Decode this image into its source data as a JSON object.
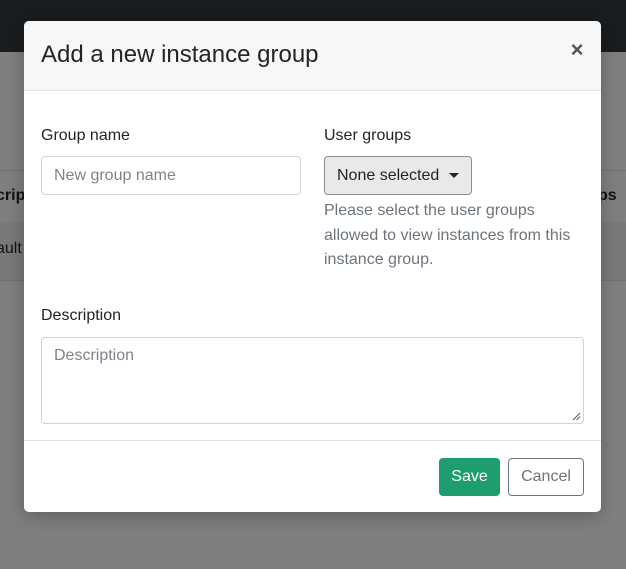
{
  "background": {
    "table_header_left": "cript",
    "table_header_right": "ps",
    "table_row_left": "ault"
  },
  "modal": {
    "title": "Add a new instance group",
    "close_symbol": "×",
    "group_name": {
      "label": "Group name",
      "placeholder": "New group name",
      "value": ""
    },
    "user_groups": {
      "label": "User groups",
      "selected": "None selected",
      "help": "Please select the user groups allowed to view instances from this instance group."
    },
    "description": {
      "label": "Description",
      "placeholder": "Description",
      "value": ""
    },
    "footer": {
      "save_label": "Save",
      "cancel_label": "Cancel"
    }
  },
  "colors": {
    "primary": "#1e9e6e",
    "topbar": "#343a40"
  },
  "icons": [
    "close-icon",
    "caret-down-icon",
    "resize-grip-icon"
  ]
}
